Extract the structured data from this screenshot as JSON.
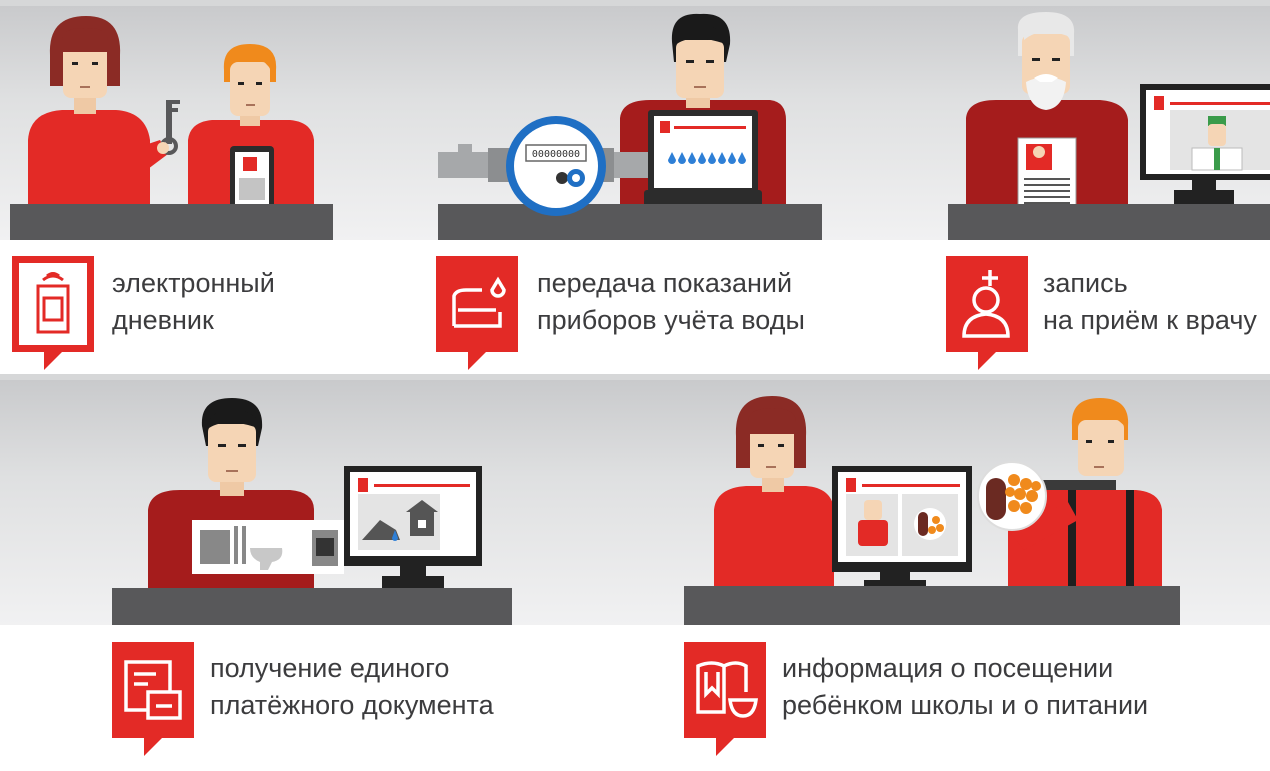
{
  "services": [
    {
      "id": "diary",
      "icon": "school-id-card-icon",
      "line1": "электронный",
      "line2": "дневник"
    },
    {
      "id": "water",
      "icon": "water-meter-icon",
      "line1": "передача показаний",
      "line2": "приборов учёта воды"
    },
    {
      "id": "doctor",
      "icon": "doctor-icon",
      "line1": "запись",
      "line2": "на приём к врачу"
    },
    {
      "id": "payment",
      "icon": "payment-document-icon",
      "line1": "получение единого",
      "line2": "платёжного документа"
    },
    {
      "id": "school",
      "icon": "book-and-bowl-icon",
      "line1": "информация о посещении",
      "line2": "ребёнком школы и о питании"
    }
  ],
  "illustrations": {
    "meter_reading": "00000000"
  },
  "colors": {
    "brand_red": "#e32a26",
    "dark_red": "#a51c1c",
    "desk_gray": "#58585a",
    "text": "#3c3c3e"
  }
}
